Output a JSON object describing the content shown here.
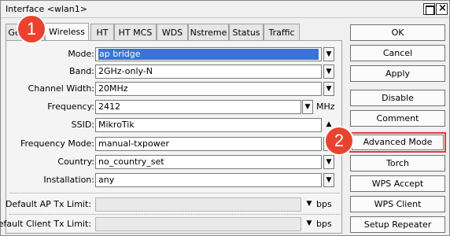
{
  "window": {
    "title": "Interface <wlan1>"
  },
  "tabs": [
    {
      "label": "General"
    },
    {
      "label": "Wireless"
    },
    {
      "label": "HT"
    },
    {
      "label": "HT MCS"
    },
    {
      "label": "WDS"
    },
    {
      "label": "Nstreme"
    },
    {
      "label": "Status"
    },
    {
      "label": "Traffic"
    }
  ],
  "form": {
    "mode": {
      "label": "Mode:",
      "value": "ap bridge"
    },
    "band": {
      "label": "Band:",
      "value": "2GHz-only-N"
    },
    "channel_width": {
      "label": "Channel Width:",
      "value": "20MHz"
    },
    "frequency": {
      "label": "Frequency:",
      "value": "2412",
      "unit": "MHz"
    },
    "ssid": {
      "label": "SSID:",
      "value": "MikroTik"
    },
    "frequency_mode": {
      "label": "Frequency Mode:",
      "value": "manual-txpower"
    },
    "country": {
      "label": "Country:",
      "value": "no_country_set"
    },
    "installation": {
      "label": "Installation:",
      "value": "any"
    },
    "default_ap_tx_limit": {
      "label": "Default AP Tx Limit:",
      "value": "",
      "unit": "bps"
    },
    "default_client_tx_limit": {
      "label": "Default Client Tx Limit:",
      "value": "",
      "unit": "bps"
    }
  },
  "buttons": {
    "ok": "OK",
    "cancel": "Cancel",
    "apply": "Apply",
    "disable": "Disable",
    "comment": "Comment",
    "advanced_mode": "Advanced Mode",
    "torch": "Torch",
    "wps_accept": "WPS Accept",
    "wps_client": "WPS Client",
    "setup_repeater": "Setup Repeater"
  },
  "annotations": {
    "badge1": "1",
    "badge2": "2"
  },
  "colors": {
    "selection": "#3a72d8",
    "highlight": "#e53935",
    "badge": "#e9432f"
  },
  "icons": {
    "dropdown": "triangle-down",
    "up": "triangle-up"
  }
}
